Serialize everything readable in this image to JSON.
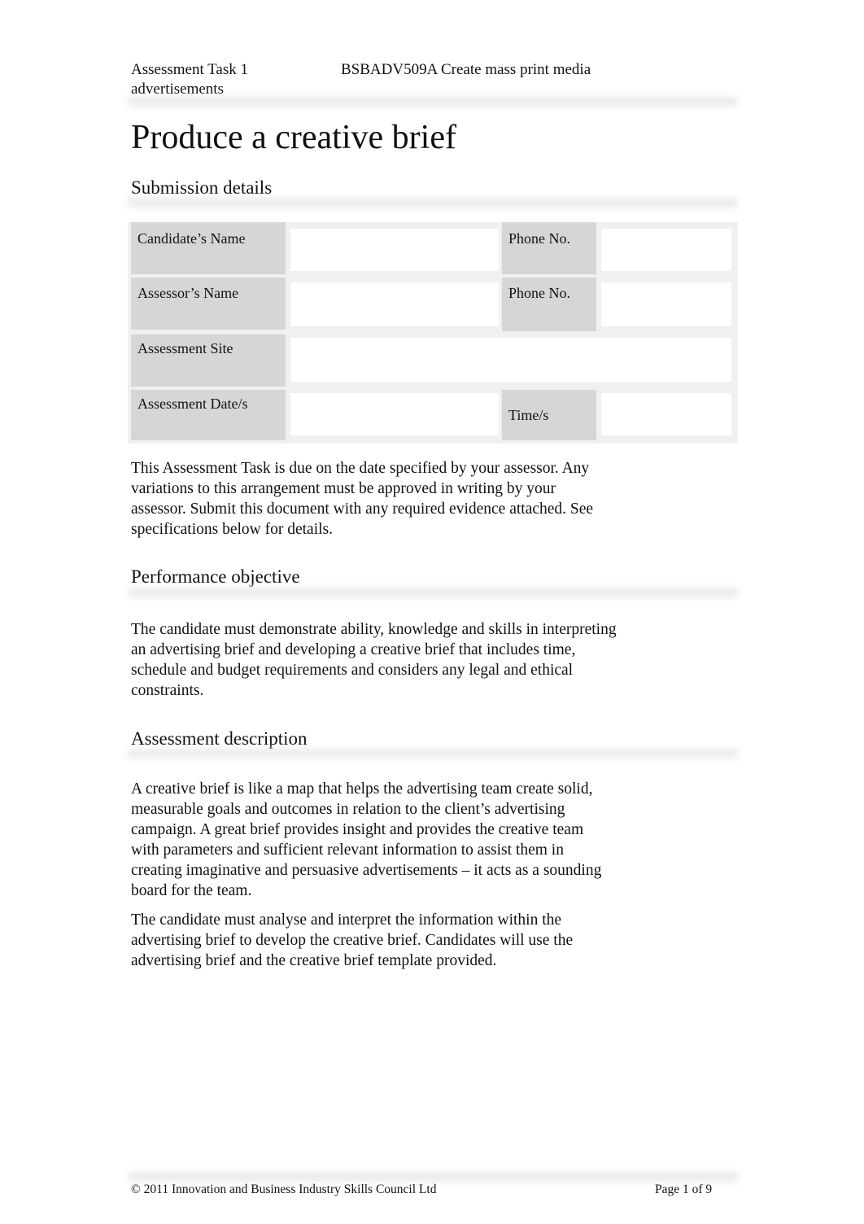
{
  "header": {
    "task": "Assessment Task 1",
    "unit": "BSBADV509A Create mass print media",
    "unit_continued": "advertisements"
  },
  "title": "Produce a creative brief",
  "sections": {
    "submission": {
      "heading": "Submission details",
      "form": {
        "candidate_name_label": "Candidate’s Name",
        "candidate_name_value": "",
        "candidate_phone_label": "Phone No.",
        "candidate_phone_value": "",
        "assessor_name_label": "Assessor’s Name",
        "assessor_name_value": "",
        "assessor_phone_label": "Phone No.",
        "assessor_phone_value": "",
        "site_label": "Assessment Site",
        "site_value": "",
        "dates_label": "Assessment Date/s",
        "dates_value": "",
        "time_label": "Time/s",
        "time_value": ""
      },
      "paragraph": "This Assessment Task is due on the date specified by your assessor. Any variations to this arrangement must be approved in writing by your assessor. Submit this document with any required evidence attached. See specifications below for details."
    },
    "performance": {
      "heading": "Performance objective",
      "paragraph": "The candidate must demonstrate ability, knowledge and skills in interpreting an advertising brief and developing a creative brief that includes time, schedule and budget requirements and considers any legal and ethical constraints."
    },
    "description": {
      "heading": "Assessment description",
      "paragraphs": [
        "A creative brief is like a map that helps the advertising team create solid, measurable goals and outcomes in relation to the client’s advertising campaign. A great brief provides insight and provides the creative team with parameters and sufficient relevant information to assist them in creating imaginative and persuasive advertisements – it acts as a sounding board for the team.",
        "The candidate must analyse and interpret the information within the advertising brief to develop the creative brief. Candidates will use the advertising brief and the creative brief template provided."
      ]
    }
  },
  "footer": {
    "copyright": "© 2011 Innovation and Business Industry Skills Council Ltd",
    "page": "Page 1 of 9"
  }
}
